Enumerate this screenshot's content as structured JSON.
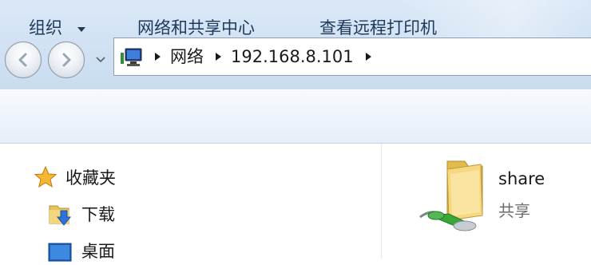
{
  "address": {
    "crumbs": [
      "网络",
      "192.168.8.101"
    ]
  },
  "toolbar": {
    "organize_label": "组织",
    "network_center_label": "网络和共享中心",
    "printers_label": "查看远程打印机"
  },
  "navigation": {
    "favorites_label": "收藏夹",
    "items": [
      "下载",
      "桌面"
    ]
  },
  "files": [
    {
      "name": "share",
      "type": "共享"
    }
  ],
  "colors": {
    "chrome": "#d3e3f4",
    "toolbar_text": "#1e395b",
    "folder": "#f2d37a",
    "share_accent": "#3aa63a"
  },
  "icons": [
    "back-icon",
    "forward-icon",
    "network-computer-icon",
    "star-icon",
    "download-folder-icon",
    "desktop-icon",
    "shared-folder-icon"
  ]
}
